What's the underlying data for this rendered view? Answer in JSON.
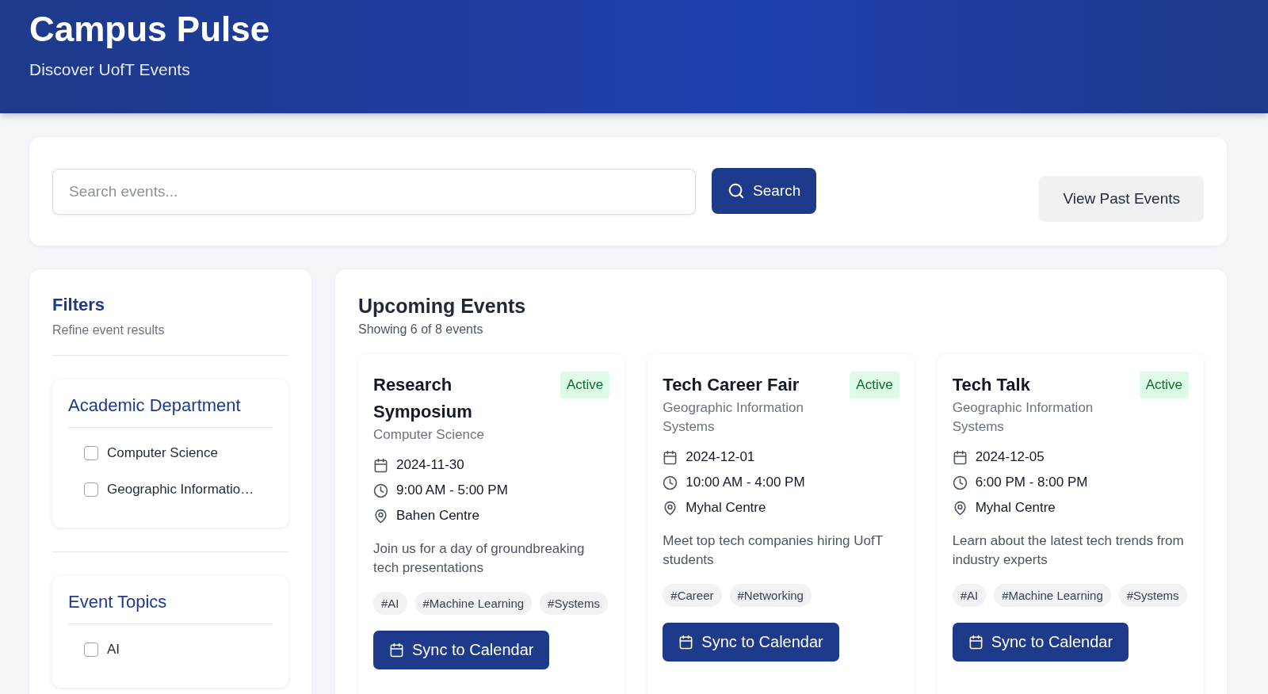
{
  "header": {
    "title": "Campus Pulse",
    "subtitle": "Discover UofT Events"
  },
  "search": {
    "placeholder": "Search events...",
    "button": "Search",
    "past_button": "View Past Events"
  },
  "filters": {
    "title": "Filters",
    "subtitle": "Refine event results",
    "groups": [
      {
        "title": "Academic Department",
        "options": [
          {
            "label": "Computer Science",
            "checked": false
          },
          {
            "label": "Geographic Informatio…",
            "checked": false
          }
        ]
      },
      {
        "title": "Event Topics",
        "options": [
          {
            "label": "AI",
            "checked": false
          }
        ]
      }
    ]
  },
  "events": {
    "title": "Upcoming Events",
    "count": "Showing 6 of 8 events",
    "items": [
      {
        "title": "Research Symposium",
        "status": "Active",
        "department": "Computer Science",
        "date": "2024-11-30",
        "time": "9:00 AM - 5:00 PM",
        "location": "Bahen Centre",
        "description": "Join us for a day of groundbreaking tech presentations",
        "tags": [
          "#AI",
          "#Machine Learning",
          "#Systems"
        ],
        "button": "Sync to Calendar"
      },
      {
        "title": "Tech Career Fair",
        "status": "Active",
        "department": "Geographic Information Systems",
        "date": "2024-12-01",
        "time": "10:00 AM - 4:00 PM",
        "location": "Myhal Centre",
        "description": "Meet top tech companies hiring UofT students",
        "tags": [
          "#Career",
          "#Networking"
        ],
        "button": "Sync to Calendar"
      },
      {
        "title": "Tech Talk",
        "status": "Active",
        "department": "Geographic Information Systems",
        "date": "2024-12-05",
        "time": "6:00 PM - 8:00 PM",
        "location": "Myhal Centre",
        "description": "Learn about the latest tech trends from industry experts",
        "tags": [
          "#AI",
          "#Machine Learning",
          "#Systems"
        ],
        "button": "Sync to Calendar"
      }
    ]
  }
}
